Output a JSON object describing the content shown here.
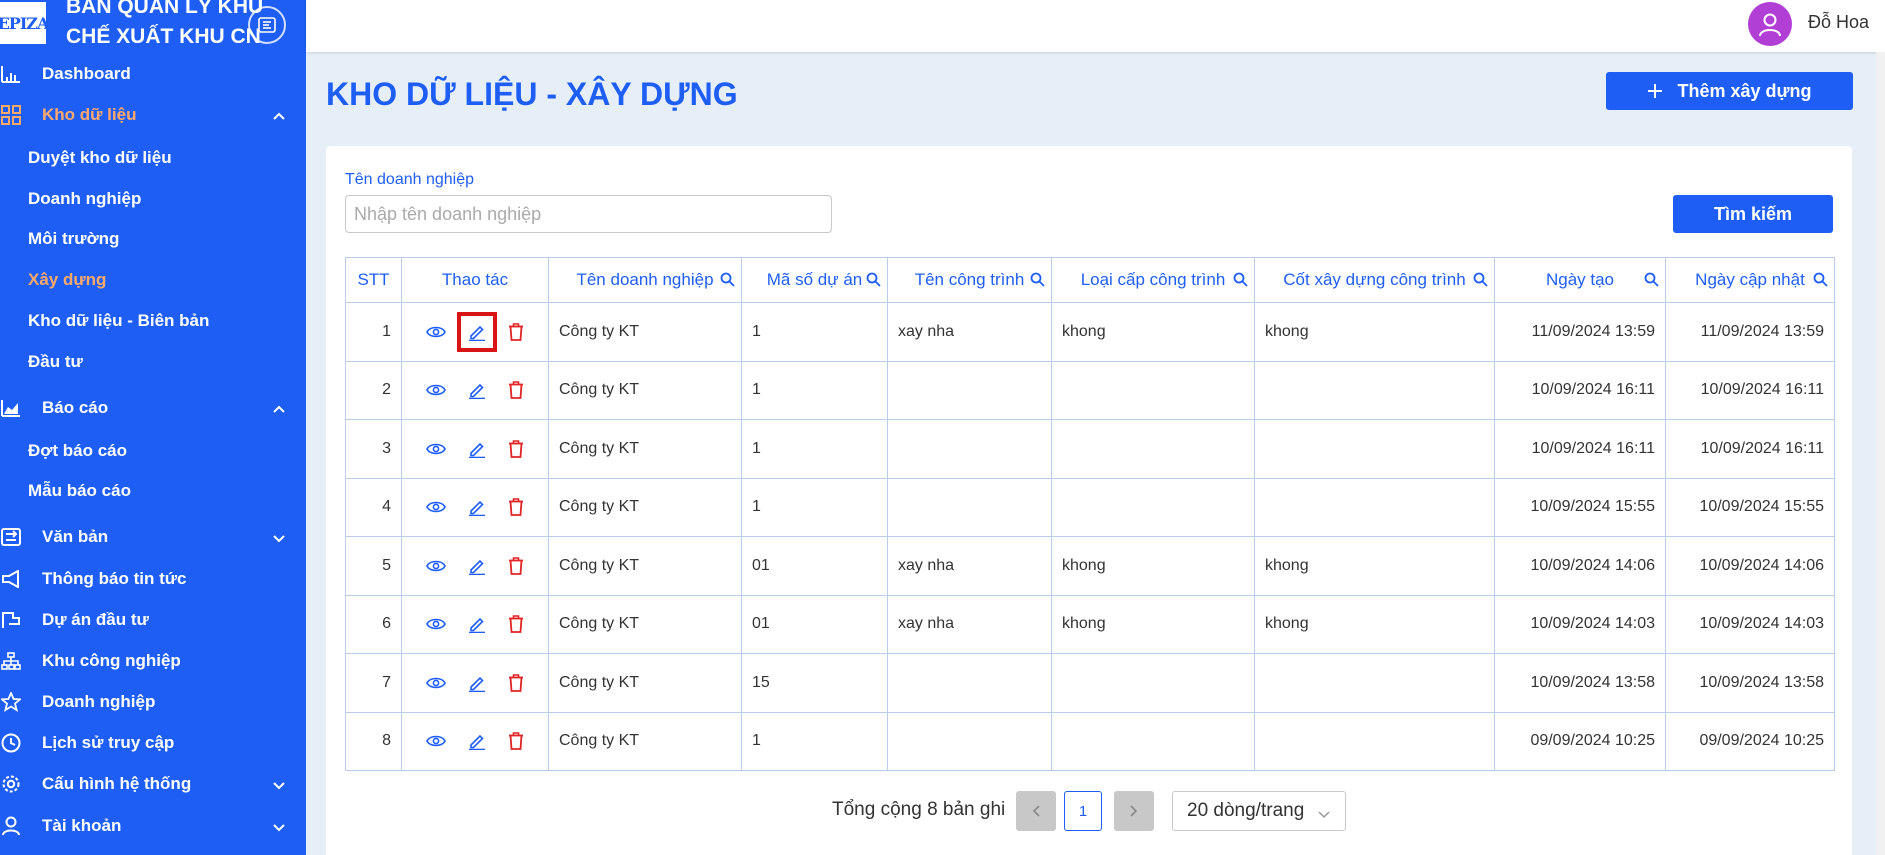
{
  "app": {
    "logo_text": "EPIZA",
    "org_line1": "BAN QUẢN LÝ KHU",
    "org_line2": "CHẾ XUẤT KHU CN"
  },
  "user": {
    "name": "Đỗ Hoa"
  },
  "sidebar": {
    "items": [
      {
        "label": "Dashboard",
        "icon": "chart-bar-icon"
      },
      {
        "label": "Kho dữ liệu",
        "icon": "grid-icon"
      },
      {
        "label": "Duyệt kho dữ liệu"
      },
      {
        "label": "Doanh nghiệp"
      },
      {
        "label": "Môi trường"
      },
      {
        "label": "Xây dựng"
      },
      {
        "label": "Kho dữ liệu - Biên bản"
      },
      {
        "label": "Đầu tư"
      },
      {
        "label": "Báo cáo",
        "icon": "area-chart-icon"
      },
      {
        "label": "Đợt báo cáo"
      },
      {
        "label": "Mẫu báo cáo"
      },
      {
        "label": "Văn bản",
        "icon": "document-transfer-icon"
      },
      {
        "label": "Thông báo tin tức",
        "icon": "megaphone-icon"
      },
      {
        "label": "Dự án đầu tư",
        "icon": "flag-icon"
      },
      {
        "label": "Khu công nghiệp",
        "icon": "hierarchy-icon"
      },
      {
        "label": "Doanh nghiệp",
        "icon": "star-icon"
      },
      {
        "label": "Lịch sử truy cập",
        "icon": "clock-icon"
      },
      {
        "label": "Cấu hình hệ thống",
        "icon": "gear-icon"
      },
      {
        "label": "Tài khoản",
        "icon": "user-icon"
      }
    ]
  },
  "page": {
    "title": "KHO DỮ LIỆU - XÂY DỰNG",
    "add_button": "Thêm xây dựng"
  },
  "filter": {
    "label": "Tên doanh nghiệp",
    "placeholder": "Nhập tên doanh nghiệp",
    "value": "",
    "search_button": "Tìm kiếm"
  },
  "table": {
    "columns": [
      "STT",
      "Thao tác",
      "Tên doanh nghiệp",
      "Mã số dự án",
      "Tên công trình",
      "Loại cấp công trình",
      "Cốt xây dựng công trình",
      "Ngày tạo",
      "Ngày cập nhật"
    ],
    "rows": [
      {
        "stt": "1",
        "company": "Công ty KT",
        "project_code": "1",
        "work_name": "xay nha",
        "grade": "khong",
        "level": "khong",
        "created": "11/09/2024 13:59",
        "updated": "11/09/2024 13:59"
      },
      {
        "stt": "2",
        "company": "Công ty KT",
        "project_code": "1",
        "work_name": "",
        "grade": "",
        "level": "",
        "created": "10/09/2024 16:11",
        "updated": "10/09/2024 16:11"
      },
      {
        "stt": "3",
        "company": "Công ty KT",
        "project_code": "1",
        "work_name": "",
        "grade": "",
        "level": "",
        "created": "10/09/2024 16:11",
        "updated": "10/09/2024 16:11"
      },
      {
        "stt": "4",
        "company": "Công ty KT",
        "project_code": "1",
        "work_name": "",
        "grade": "",
        "level": "",
        "created": "10/09/2024 15:55",
        "updated": "10/09/2024 15:55"
      },
      {
        "stt": "5",
        "company": "Công ty KT",
        "project_code": "01",
        "work_name": "xay nha",
        "grade": "khong",
        "level": "khong",
        "created": "10/09/2024 14:06",
        "updated": "10/09/2024 14:06"
      },
      {
        "stt": "6",
        "company": "Công ty KT",
        "project_code": "01",
        "work_name": "xay nha",
        "grade": "khong",
        "level": "khong",
        "created": "10/09/2024 14:03",
        "updated": "10/09/2024 14:03"
      },
      {
        "stt": "7",
        "company": "Công ty KT",
        "project_code": "15",
        "work_name": "",
        "grade": "",
        "level": "",
        "created": "10/09/2024 13:58",
        "updated": "10/09/2024 13:58"
      },
      {
        "stt": "8",
        "company": "Công ty KT",
        "project_code": "1",
        "work_name": "",
        "grade": "",
        "level": "",
        "created": "09/09/2024 10:25",
        "updated": "09/09/2024 10:25"
      }
    ]
  },
  "pagination": {
    "total_text": "Tổng cộng 8 bản ghi",
    "current_page": "1",
    "page_size": "20 dòng/trang"
  },
  "colors": {
    "primary": "#1e5ef5",
    "sidebar_active": "#ffa96b",
    "delete": "#e02424",
    "highlight": "#d81414"
  }
}
